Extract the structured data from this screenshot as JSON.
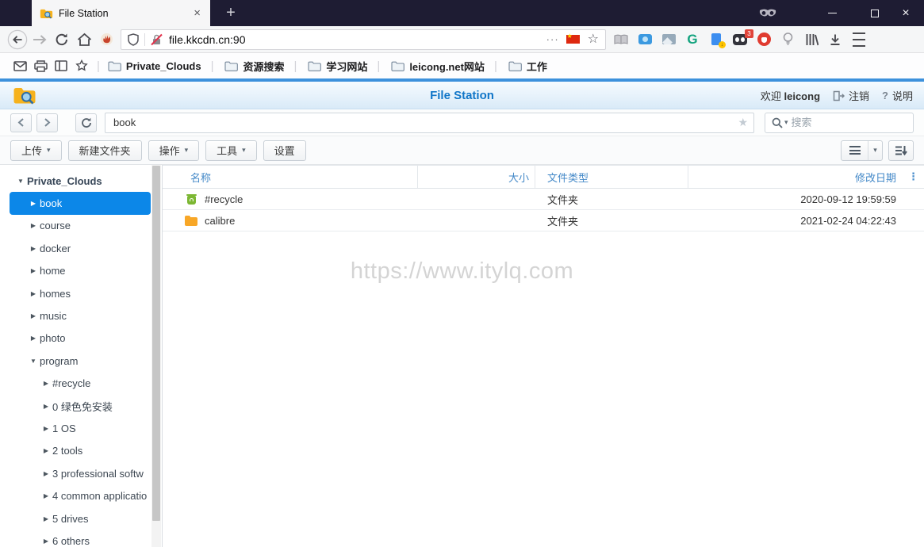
{
  "icons": {
    "more_options": "···",
    "bookmark_star": "☆",
    "path_star": "★",
    "caret_down": "▾",
    "tree_collapsed": "▶",
    "tree_expanded": "▼",
    "column_menu": "⋮",
    "new_tab": "+",
    "tab_close": "×",
    "window_close": "×",
    "flag_star": "★",
    "green_g": "G",
    "badge_count": "3",
    "doc_arrow": "↓",
    "help_glyph": "?"
  },
  "browser": {
    "tab_title": "File Station",
    "url": "file.kkcdn.cn:90",
    "bookmarks": [
      "Private_Clouds",
      "资源搜索",
      "学习网站",
      "leicong.net网站",
      "工作"
    ]
  },
  "file_station": {
    "title": "File Station",
    "welcome_prefix": "欢迎",
    "username": "leicong",
    "logout_label": "注销",
    "help_label": "说明",
    "path_value": "book",
    "search_placeholder": "搜索",
    "toolbar": {
      "upload": "上传",
      "new_folder": "新建文件夹",
      "action": "操作",
      "tools": "工具",
      "settings": "设置"
    }
  },
  "sidebar": {
    "root_label": "Private_Clouds",
    "items": [
      {
        "label": "book",
        "level": 1,
        "selected": true
      },
      {
        "label": "course",
        "level": 1
      },
      {
        "label": "docker",
        "level": 1
      },
      {
        "label": "home",
        "level": 1
      },
      {
        "label": "homes",
        "level": 1
      },
      {
        "label": "music",
        "level": 1
      },
      {
        "label": "photo",
        "level": 1
      },
      {
        "label": "program",
        "level": 1,
        "expanded": true
      },
      {
        "label": "#recycle",
        "level": 2
      },
      {
        "label": "0 绿色免安装",
        "level": 2
      },
      {
        "label": "1 OS",
        "level": 2
      },
      {
        "label": "2 tools",
        "level": 2
      },
      {
        "label": "3 professional softw",
        "level": 2
      },
      {
        "label": "4 common applicatio",
        "level": 2
      },
      {
        "label": "5 drives",
        "level": 2
      },
      {
        "label": "6 others",
        "level": 2
      }
    ]
  },
  "file_table": {
    "columns": {
      "name": "名称",
      "size": "大小",
      "type": "文件类型",
      "modified": "修改日期"
    },
    "rows": [
      {
        "name": "#recycle",
        "icon": "recycle",
        "size": "",
        "type": "文件夹",
        "modified": "2020-09-12 19:59:59"
      },
      {
        "name": "calibre",
        "icon": "folder",
        "size": "",
        "type": "文件夹",
        "modified": "2021-02-24 04:22:43"
      }
    ]
  },
  "watermark": "https://www.itylq.com",
  "colors": {
    "accent_blue": "#0c87e8",
    "header_title_blue": "#1176c8",
    "table_header_blue": "#4489c8",
    "titlebar_bg": "#1e1c33",
    "recycle_green": "#7cb733",
    "folder_orange": "#f8a727"
  }
}
